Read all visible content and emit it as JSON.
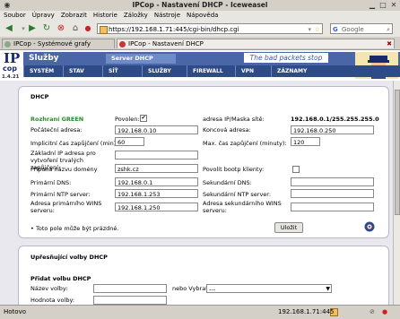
{
  "window": {
    "title": "IPCop - Nastavení DHCP - Iceweasel"
  },
  "menubar": [
    "Soubor",
    "Úpravy",
    "Zobrazit",
    "Historie",
    "Záložky",
    "Nástroje",
    "Nápověda"
  ],
  "navbar": {
    "url": "https://192.168.1.71:445/cgi-bin/dhcp.cgi",
    "search_placeholder": "Google"
  },
  "tabs": [
    {
      "label": "IPCop - Systémové grafy"
    },
    {
      "label": "IPCop - Nastavení DHCP"
    }
  ],
  "header": {
    "logo_big": "IP",
    "logo_small": "cop",
    "version": "1.4.21",
    "section": "Služby",
    "subtab": "Server DHCP",
    "slogan": "The bad packets stop here.",
    "nav": [
      "SYSTÉM",
      "STAV",
      "SÍŤ",
      "SLUŽBY",
      "FIREWALL",
      "VPN",
      "ZÁZNAMY"
    ]
  },
  "dhcp": {
    "title": "DHCP",
    "interface": "Rozhraní GREEN",
    "enabled_label": "Povolen:",
    "enabled_mark": "✔",
    "ip_mask_label": "adresa IP/Maska sítě:",
    "ip_mask_value": "192.168.0.1/255.255.255.0",
    "start_label": "Počáteční adresa:",
    "start_value": "192.168.0.10",
    "end_label": "Koncová adresa:",
    "end_value": "192.168.0.250",
    "default_lease_label": "Implicitní čas zapůjčení (min):",
    "default_lease_value": "60",
    "max_lease_label": "Max. čas zapůjčení (minuty):",
    "max_lease_value": "120",
    "fixed_lease_label": "Základní IP adresa pro vytvoření trvalých zapůjčení:",
    "fixed_lease_value": "",
    "domain_label": "Přípona názvu domény",
    "domain_value": "zshk.cz",
    "bootp_label": "Povolit bootp klienty:",
    "dns1_label": "Primární DNS:",
    "dns1_value": "192.168.0.1",
    "dns2_label": "Sekundární DNS:",
    "dns2_value": "",
    "ntp1_label": "Primární NTP server:",
    "ntp1_value": "192.168.1.253",
    "ntp2_label": "Sekundární NTP server:",
    "ntp2_value": "",
    "wins1_label": "Adresa primárního WINS serveru:",
    "wins1_value": "192.168.1.250",
    "wins2_label": "Adresa sekundárního WINS serveru:",
    "wins2_value": "",
    "note": "Toto pole může být prázdné.",
    "save_label": "Uložit"
  },
  "advanced": {
    "title": "Upřesňující volby DHCP",
    "add_title": "Přidat volbu DHCP",
    "name_label": "Název volby:",
    "or_choose_label": "nebo Vybrat",
    "select_value": "---",
    "value_label": "Hodnota volby:"
  },
  "statusbar": {
    "text": "Hotovo",
    "address": "192.168.1.71:445"
  }
}
